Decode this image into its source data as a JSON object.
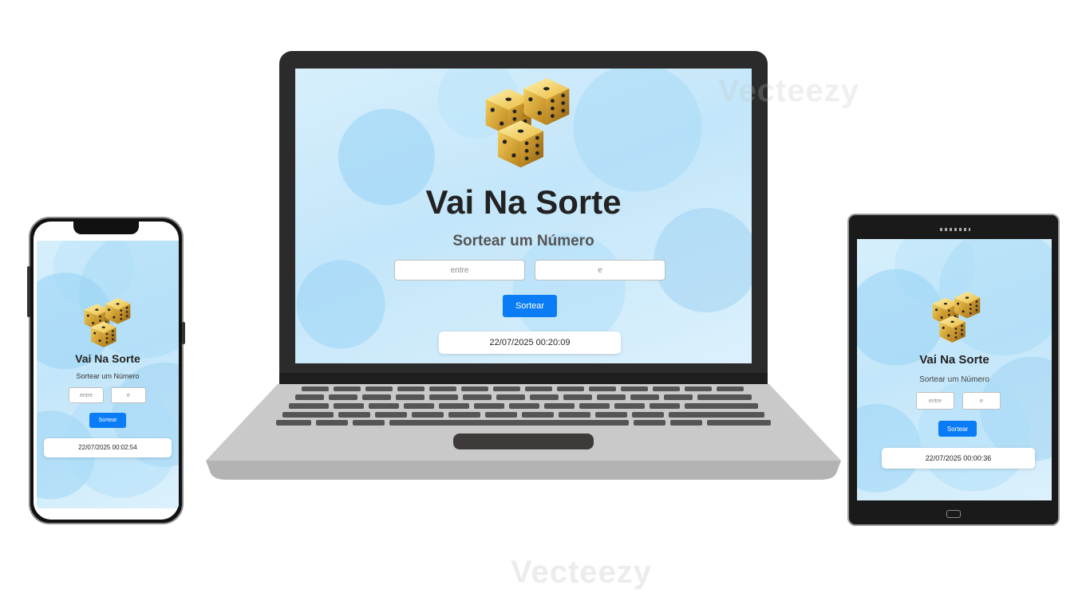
{
  "laptop": {
    "title": "Vai Na Sorte",
    "subtitle": "Sortear um Número",
    "input_from_placeholder": "entre",
    "input_to_placeholder": "e",
    "button_label": "Sortear",
    "result": "22/07/2025 00:20:09"
  },
  "phone": {
    "title": "Vai Na Sorte",
    "subtitle": "Sortear um Número",
    "input_from_placeholder": "entre",
    "input_to_placeholder": "e",
    "button_label": "Sortear",
    "result": "22/07/2025 00:02:54"
  },
  "tablet": {
    "title": "Vai Na Sorte",
    "subtitle": "Sortear um Número",
    "input_from_placeholder": "entre",
    "input_to_placeholder": "e",
    "button_label": "Sortear",
    "result": "22/07/2025 00:00:36"
  },
  "watermark": "Vecteezy",
  "colors": {
    "button": "#0a7cf5",
    "screen_bg": "#c9e9fb",
    "device_dark": "#2b2b2b",
    "laptop_base": "#c8c8c8"
  }
}
